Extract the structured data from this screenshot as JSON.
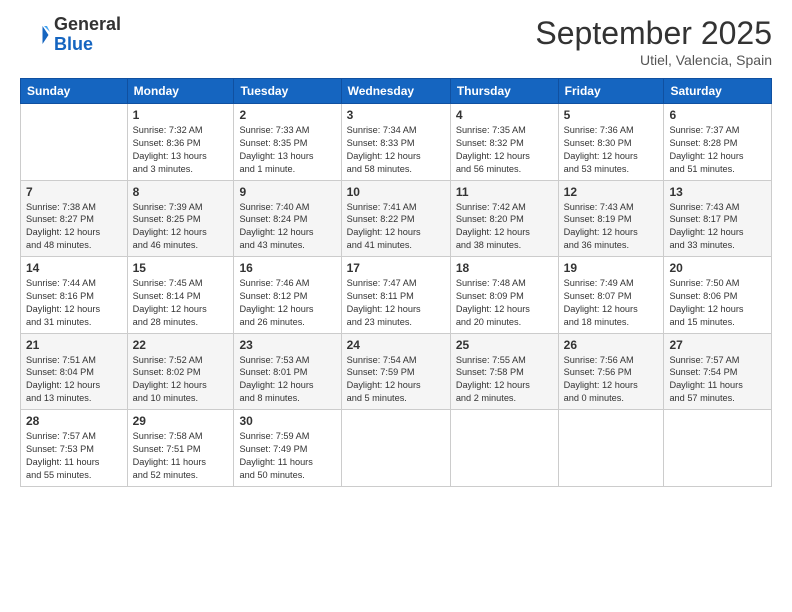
{
  "header": {
    "logo_general": "General",
    "logo_blue": "Blue",
    "month": "September 2025",
    "location": "Utiel, Valencia, Spain"
  },
  "weekdays": [
    "Sunday",
    "Monday",
    "Tuesday",
    "Wednesday",
    "Thursday",
    "Friday",
    "Saturday"
  ],
  "weeks": [
    [
      {
        "day": "",
        "info": ""
      },
      {
        "day": "1",
        "info": "Sunrise: 7:32 AM\nSunset: 8:36 PM\nDaylight: 13 hours\nand 3 minutes."
      },
      {
        "day": "2",
        "info": "Sunrise: 7:33 AM\nSunset: 8:35 PM\nDaylight: 13 hours\nand 1 minute."
      },
      {
        "day": "3",
        "info": "Sunrise: 7:34 AM\nSunset: 8:33 PM\nDaylight: 12 hours\nand 58 minutes."
      },
      {
        "day": "4",
        "info": "Sunrise: 7:35 AM\nSunset: 8:32 PM\nDaylight: 12 hours\nand 56 minutes."
      },
      {
        "day": "5",
        "info": "Sunrise: 7:36 AM\nSunset: 8:30 PM\nDaylight: 12 hours\nand 53 minutes."
      },
      {
        "day": "6",
        "info": "Sunrise: 7:37 AM\nSunset: 8:28 PM\nDaylight: 12 hours\nand 51 minutes."
      }
    ],
    [
      {
        "day": "7",
        "info": "Sunrise: 7:38 AM\nSunset: 8:27 PM\nDaylight: 12 hours\nand 48 minutes."
      },
      {
        "day": "8",
        "info": "Sunrise: 7:39 AM\nSunset: 8:25 PM\nDaylight: 12 hours\nand 46 minutes."
      },
      {
        "day": "9",
        "info": "Sunrise: 7:40 AM\nSunset: 8:24 PM\nDaylight: 12 hours\nand 43 minutes."
      },
      {
        "day": "10",
        "info": "Sunrise: 7:41 AM\nSunset: 8:22 PM\nDaylight: 12 hours\nand 41 minutes."
      },
      {
        "day": "11",
        "info": "Sunrise: 7:42 AM\nSunset: 8:20 PM\nDaylight: 12 hours\nand 38 minutes."
      },
      {
        "day": "12",
        "info": "Sunrise: 7:43 AM\nSunset: 8:19 PM\nDaylight: 12 hours\nand 36 minutes."
      },
      {
        "day": "13",
        "info": "Sunrise: 7:43 AM\nSunset: 8:17 PM\nDaylight: 12 hours\nand 33 minutes."
      }
    ],
    [
      {
        "day": "14",
        "info": "Sunrise: 7:44 AM\nSunset: 8:16 PM\nDaylight: 12 hours\nand 31 minutes."
      },
      {
        "day": "15",
        "info": "Sunrise: 7:45 AM\nSunset: 8:14 PM\nDaylight: 12 hours\nand 28 minutes."
      },
      {
        "day": "16",
        "info": "Sunrise: 7:46 AM\nSunset: 8:12 PM\nDaylight: 12 hours\nand 26 minutes."
      },
      {
        "day": "17",
        "info": "Sunrise: 7:47 AM\nSunset: 8:11 PM\nDaylight: 12 hours\nand 23 minutes."
      },
      {
        "day": "18",
        "info": "Sunrise: 7:48 AM\nSunset: 8:09 PM\nDaylight: 12 hours\nand 20 minutes."
      },
      {
        "day": "19",
        "info": "Sunrise: 7:49 AM\nSunset: 8:07 PM\nDaylight: 12 hours\nand 18 minutes."
      },
      {
        "day": "20",
        "info": "Sunrise: 7:50 AM\nSunset: 8:06 PM\nDaylight: 12 hours\nand 15 minutes."
      }
    ],
    [
      {
        "day": "21",
        "info": "Sunrise: 7:51 AM\nSunset: 8:04 PM\nDaylight: 12 hours\nand 13 minutes."
      },
      {
        "day": "22",
        "info": "Sunrise: 7:52 AM\nSunset: 8:02 PM\nDaylight: 12 hours\nand 10 minutes."
      },
      {
        "day": "23",
        "info": "Sunrise: 7:53 AM\nSunset: 8:01 PM\nDaylight: 12 hours\nand 8 minutes."
      },
      {
        "day": "24",
        "info": "Sunrise: 7:54 AM\nSunset: 7:59 PM\nDaylight: 12 hours\nand 5 minutes."
      },
      {
        "day": "25",
        "info": "Sunrise: 7:55 AM\nSunset: 7:58 PM\nDaylight: 12 hours\nand 2 minutes."
      },
      {
        "day": "26",
        "info": "Sunrise: 7:56 AM\nSunset: 7:56 PM\nDaylight: 12 hours\nand 0 minutes."
      },
      {
        "day": "27",
        "info": "Sunrise: 7:57 AM\nSunset: 7:54 PM\nDaylight: 11 hours\nand 57 minutes."
      }
    ],
    [
      {
        "day": "28",
        "info": "Sunrise: 7:57 AM\nSunset: 7:53 PM\nDaylight: 11 hours\nand 55 minutes."
      },
      {
        "day": "29",
        "info": "Sunrise: 7:58 AM\nSunset: 7:51 PM\nDaylight: 11 hours\nand 52 minutes."
      },
      {
        "day": "30",
        "info": "Sunrise: 7:59 AM\nSunset: 7:49 PM\nDaylight: 11 hours\nand 50 minutes."
      },
      {
        "day": "",
        "info": ""
      },
      {
        "day": "",
        "info": ""
      },
      {
        "day": "",
        "info": ""
      },
      {
        "day": "",
        "info": ""
      }
    ]
  ]
}
